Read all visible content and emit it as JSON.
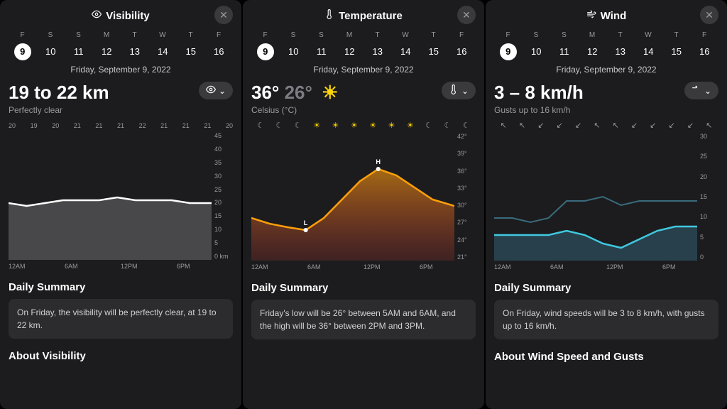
{
  "panels": {
    "visibility": {
      "title": "Visibility",
      "dates": {
        "dows": [
          "F",
          "S",
          "S",
          "M",
          "T",
          "W",
          "T",
          "F"
        ],
        "days": [
          "9",
          "10",
          "11",
          "12",
          "13",
          "14",
          "15",
          "16"
        ],
        "selected": 0,
        "full": "Friday, September 9, 2022"
      },
      "main": "19 to 22 km",
      "sub": "Perfectly clear",
      "hour_top": [
        "20",
        "19",
        "20",
        "21",
        "21",
        "21",
        "22",
        "21",
        "21",
        "21",
        "20"
      ],
      "y_ticks": [
        "45",
        "40",
        "35",
        "30",
        "25",
        "20",
        "15",
        "10",
        "5",
        "0 km"
      ],
      "x_ticks": [
        "12AM",
        "6AM",
        "12PM",
        "6PM"
      ],
      "summary_title": "Daily Summary",
      "summary": "On Friday, the visibility will be perfectly clear, at 19 to 22 km.",
      "about": "About Visibility"
    },
    "temperature": {
      "title": "Temperature",
      "dates": {
        "dows": [
          "F",
          "S",
          "S",
          "M",
          "T",
          "W",
          "T",
          "F"
        ],
        "days": [
          "9",
          "10",
          "11",
          "12",
          "13",
          "14",
          "15",
          "16"
        ],
        "selected": 0,
        "full": "Friday, September 9, 2022"
      },
      "high": "36°",
      "low": "26°",
      "sub": "Celsius (°C)",
      "hour_icons": [
        "moon",
        "moon",
        "moon",
        "sun",
        "sun",
        "sun",
        "sun",
        "sun",
        "sun",
        "moon",
        "moon",
        "moon"
      ],
      "y_ticks": [
        "42°",
        "39°",
        "36°",
        "33°",
        "30°",
        "27°",
        "24°",
        "21°"
      ],
      "x_ticks": [
        "12AM",
        "6AM",
        "12PM",
        "6PM"
      ],
      "summary_title": "Daily Summary",
      "summary": "Friday's low will be 26° between 5AM and 6AM, and the high will be 36° between 2PM and 3PM.",
      "h_label": "H",
      "l_label": "L"
    },
    "wind": {
      "title": "Wind",
      "dates": {
        "dows": [
          "F",
          "S",
          "S",
          "M",
          "T",
          "W",
          "T",
          "F"
        ],
        "days": [
          "9",
          "10",
          "11",
          "12",
          "13",
          "14",
          "15",
          "16"
        ],
        "selected": 0,
        "full": "Friday, September 9, 2022"
      },
      "main": "3 – 8 km/h",
      "sub": "Gusts up to 16 km/h",
      "arrows": [
        "↖",
        "↖",
        "↙",
        "↙",
        "↙",
        "↖",
        "↖",
        "↙",
        "↙",
        "↙",
        "↙",
        "↖"
      ],
      "y_ticks": [
        "30",
        "25",
        "20",
        "15",
        "10",
        "5",
        "0"
      ],
      "x_ticks": [
        "12AM",
        "6AM",
        "12PM",
        "6PM"
      ],
      "summary_title": "Daily Summary",
      "summary": "On Friday, wind speeds will be 3 to 8 km/h, with gusts up to 16 km/h.",
      "about": "About Wind Speed and Gusts"
    }
  },
  "chart_data": [
    {
      "type": "area",
      "title": "Visibility",
      "x": [
        "12AM",
        "2AM",
        "4AM",
        "6AM",
        "8AM",
        "10AM",
        "12PM",
        "2PM",
        "4PM",
        "6PM",
        "8PM",
        "10PM"
      ],
      "values": [
        20,
        19,
        20,
        21,
        21,
        21,
        22,
        21,
        21,
        21,
        20,
        20
      ],
      "ylabel": "km",
      "ylim": [
        0,
        45
      ]
    },
    {
      "type": "area",
      "title": "Temperature",
      "x": [
        "12AM",
        "2AM",
        "4AM",
        "6AM",
        "8AM",
        "10AM",
        "12PM",
        "2PM",
        "4PM",
        "6PM",
        "8PM",
        "10PM"
      ],
      "values": [
        28,
        27,
        26.5,
        26,
        28,
        31,
        34,
        36,
        35,
        33,
        31,
        30
      ],
      "ylabel": "°C",
      "ylim": [
        21,
        42
      ],
      "annotations": [
        {
          "label": "L",
          "x": "6AM",
          "y": 26
        },
        {
          "label": "H",
          "x": "2PM",
          "y": 36
        }
      ]
    },
    {
      "type": "line",
      "title": "Wind",
      "x": [
        "12AM",
        "2AM",
        "4AM",
        "6AM",
        "8AM",
        "10AM",
        "12PM",
        "2PM",
        "4PM",
        "6PM",
        "8PM",
        "10PM"
      ],
      "series": [
        {
          "name": "Gusts",
          "values": [
            10,
            10,
            9,
            10,
            14,
            14,
            15,
            13,
            14,
            14,
            14,
            14
          ]
        },
        {
          "name": "Wind",
          "values": [
            6,
            6,
            6,
            6,
            7,
            6,
            4,
            3,
            5,
            7,
            8,
            8
          ]
        }
      ],
      "ylabel": "km/h",
      "ylim": [
        0,
        30
      ]
    }
  ]
}
